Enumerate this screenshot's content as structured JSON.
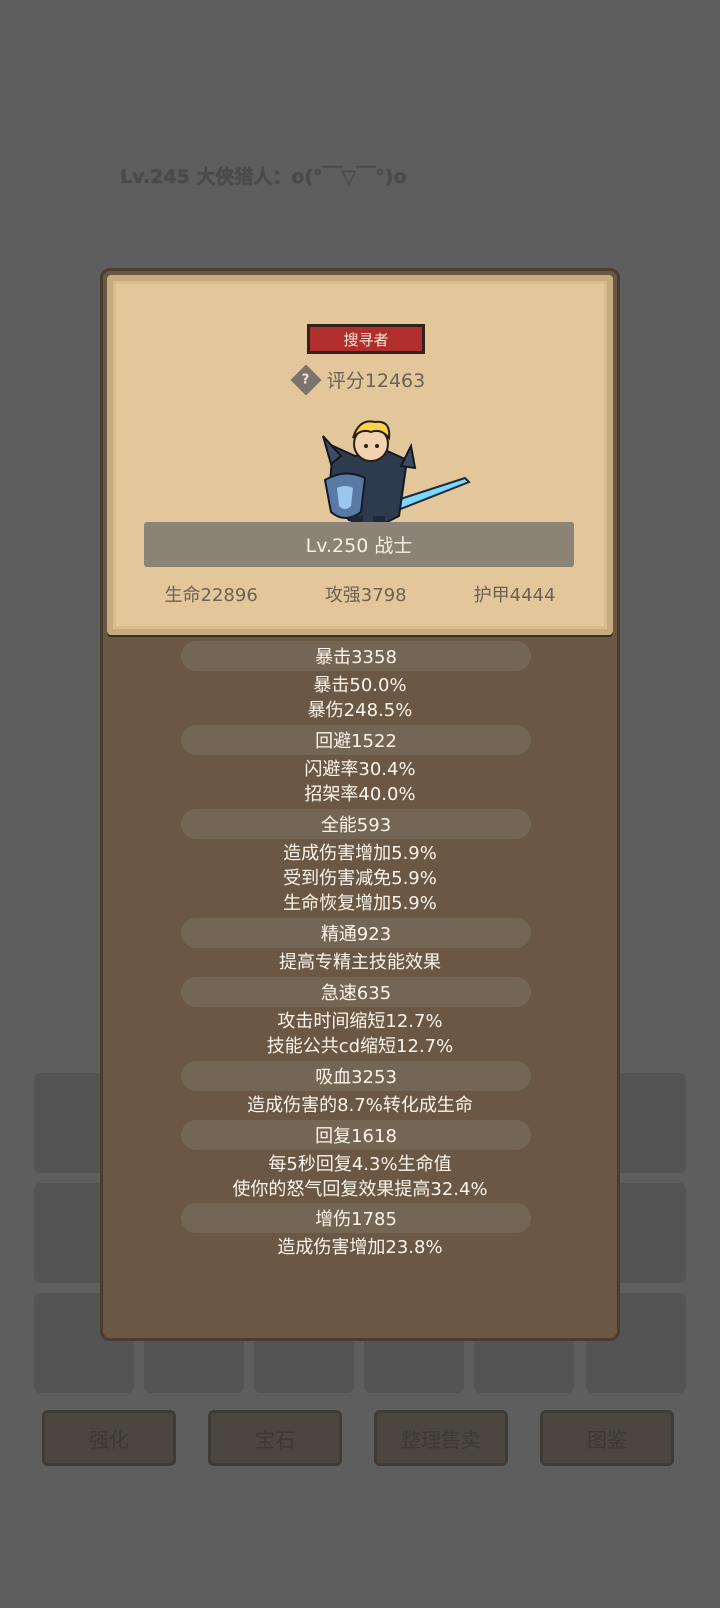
{
  "background": {
    "title": "Lv.245 大侠猎人：o(°￣▽￣°)o",
    "buttons": [
      "强化",
      "宝石",
      "整理售卖",
      "图鉴"
    ]
  },
  "card": {
    "tag": "搜寻者",
    "score": "评分12463",
    "level_class": "Lv.250 战士",
    "hp": "生命22896",
    "atk": "攻强3798",
    "armor": "护甲4444"
  },
  "attributes": [
    {
      "head": "暴击3358",
      "lines": [
        "暴击50.0%",
        "暴伤248.5%"
      ]
    },
    {
      "head": "回避1522",
      "lines": [
        "闪避率30.4%",
        "招架率40.0%"
      ]
    },
    {
      "head": "全能593",
      "lines": [
        "造成伤害增加5.9%",
        "受到伤害减免5.9%",
        "生命恢复增加5.9%"
      ]
    },
    {
      "head": "精通923",
      "lines": [
        "提高专精主技能效果"
      ]
    },
    {
      "head": "急速635",
      "lines": [
        "攻击时间缩短12.7%",
        "技能公共cd缩短12.7%"
      ]
    },
    {
      "head": "吸血3253",
      "lines": [
        "造成伤害的8.7%转化成生命"
      ]
    },
    {
      "head": "回复1618",
      "lines": [
        "每5秒回复4.3%生命值",
        "使你的怒气回复效果提高32.4%"
      ]
    },
    {
      "head": "增伤1785",
      "lines": [
        "造成伤害增加23.8%"
      ]
    }
  ]
}
